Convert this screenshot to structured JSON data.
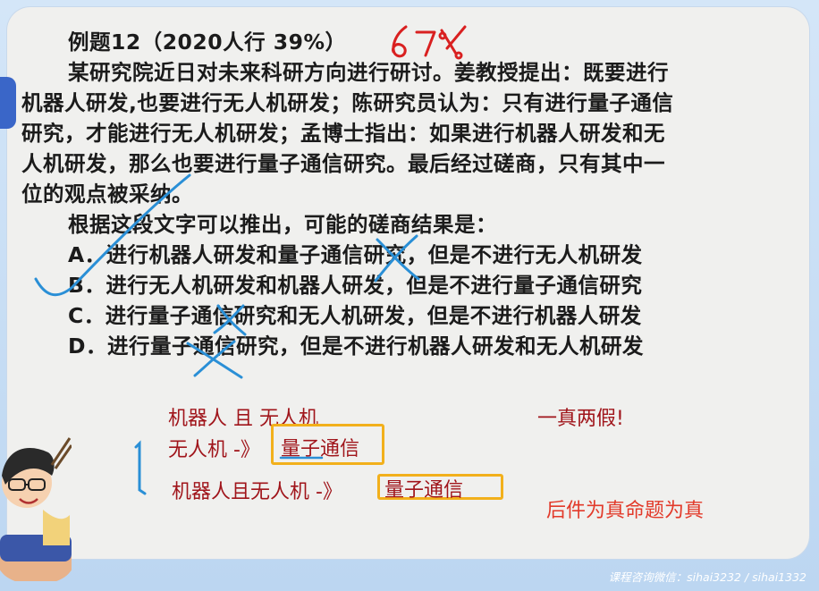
{
  "question": {
    "title": "例题12（2020人行 39%）",
    "stem_lines": [
      "某研究院近日对未来科研方向进行研讨。姜教授提出：既要进行",
      "机器人研发,也要进行无人机研发；陈研究员认为：只有进行量子通信",
      "研究，才能进行无人机研发；孟博士指出：如果进行机器人研发和无",
      "人机研发，那么也要进行量子通信研究。最后经过磋商，只有其中一",
      "位的观点被采纳。"
    ],
    "prompt": "根据这段文字可以推出，可能的磋商结果是：",
    "options": [
      "A．进行机器人研发和量子通信研究，但是不进行无人机研发",
      "B．进行无人机研发和机器人研发，但是不进行量子通信研究",
      "C．进行量子通信研究和无人机研发，但是不进行机器人研发",
      "D．进行量子通信研究，但是不进行机器人研发和无人机研发"
    ]
  },
  "annotations": {
    "handwritten_rate": "67%",
    "note1": "机器人 且  无人机",
    "note2_prefix": "无人机 -》",
    "note2_box": "量子通信",
    "note3_prefix": "机器人且无人机 -》",
    "note3_box": "量子通信",
    "right_note1": "一真两假!",
    "right_note2": "后件为真命题为真"
  },
  "footer": {
    "contact": "课程咨询微信：sihai3232 / sihai1332"
  },
  "colors": {
    "background": "#cfe3f7",
    "card": "#f0f0ee",
    "text": "#1b1b1b",
    "note_red": "#a0151b",
    "ink_blue": "#2a8fd6",
    "ink_red": "#d92020",
    "box_orange": "#f2b01b"
  }
}
